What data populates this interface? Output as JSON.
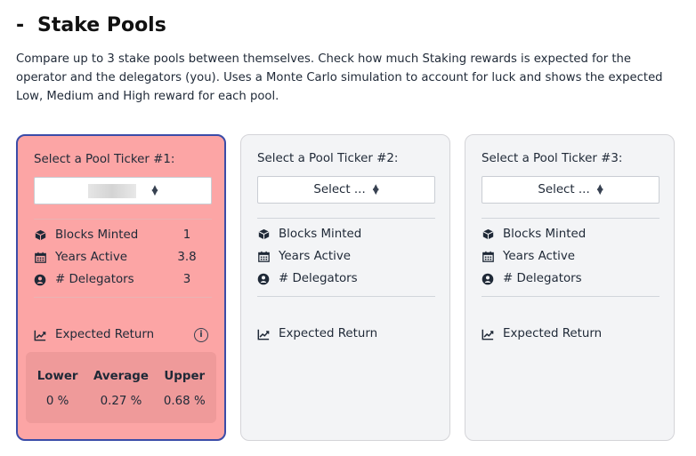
{
  "header": {
    "dash": "-",
    "title": "Stake Pools",
    "description": "Compare up to 3 stake pools between themselves. Check how much Staking rewards is expected for the operator and the delegators (you). Uses a Monte Carlo simulation to account for luck and shows the expected Low, Medium and High reward for each pool."
  },
  "pools": [
    {
      "label": "Select a Pool Ticker #1:",
      "selected": "",
      "stats": {
        "blocks_label": "Blocks Minted",
        "blocks_value": "1",
        "years_label": "Years Active",
        "years_value": "3.8",
        "delegators_label": "# Delegators",
        "delegators_value": "3"
      },
      "expected_label": "Expected Return",
      "returns": {
        "lower_label": "Lower",
        "average_label": "Average",
        "upper_label": "Upper",
        "lower": "0 %",
        "average": "0.27 %",
        "upper": "0.68 %"
      }
    },
    {
      "label": "Select a Pool Ticker #2:",
      "selected": "Select ...",
      "stats": {
        "blocks_label": "Blocks Minted",
        "years_label": "Years Active",
        "delegators_label": "# Delegators"
      },
      "expected_label": "Expected Return"
    },
    {
      "label": "Select a Pool Ticker #3:",
      "selected": "Select ...",
      "stats": {
        "blocks_label": "Blocks Minted",
        "years_label": "Years Active",
        "delegators_label": "# Delegators"
      },
      "expected_label": "Expected Return"
    }
  ],
  "colors": {
    "active_card_bg": "#fca5a5",
    "active_border": "#3b4ca8",
    "returns_bg": "#ef9a9a",
    "inactive_card_bg": "#f3f4f6"
  },
  "icons": {
    "blocks": "cube-icon",
    "years": "calendar-icon",
    "delegators": "user-circle-icon",
    "expected": "chart-line-icon",
    "info": "info-icon"
  }
}
